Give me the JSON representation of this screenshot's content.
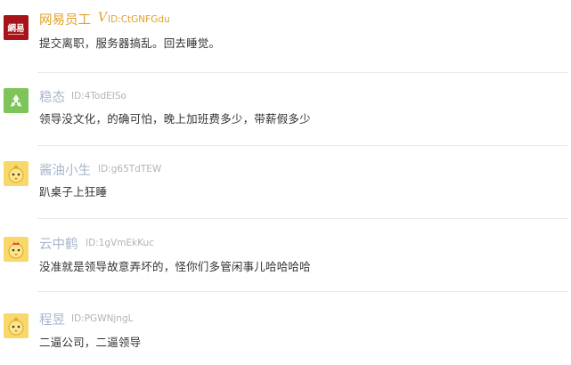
{
  "comments": [
    {
      "username": "网易员工",
      "vip_mark": "V",
      "id": "ID:CtGNFGdu",
      "text": "提交离职，服务器搞乱。回去睡觉。",
      "avatar": "netease-logo-icon",
      "avatar_text": "網易"
    },
    {
      "username": "稳态",
      "id": "ID:4TodEISo",
      "text": "领导没文化，的确可怕，晚上加班费多少，带薪假多少",
      "avatar": "recycle-icon"
    },
    {
      "username": "酱油小生",
      "id": "ID:g65TdTEW",
      "text": "趴桌子上狂睡",
      "avatar": "chick-icon"
    },
    {
      "username": "云中鹤",
      "id": "ID:1gVmEkKuc",
      "text": "没准就是领导故意弄坏的，怪你们多管闲事儿哈哈哈哈",
      "avatar": "rooster-icon"
    },
    {
      "username": "程昱",
      "id": "ID:PGWNjngL",
      "text": "二逼公司，二逼领导",
      "avatar": "chick-icon"
    }
  ],
  "colors": {
    "vip": "#e0a12a",
    "username": "#a8b6cc",
    "id": "#b3b3b3",
    "text": "#333333",
    "divider": "#e9e9e9"
  }
}
